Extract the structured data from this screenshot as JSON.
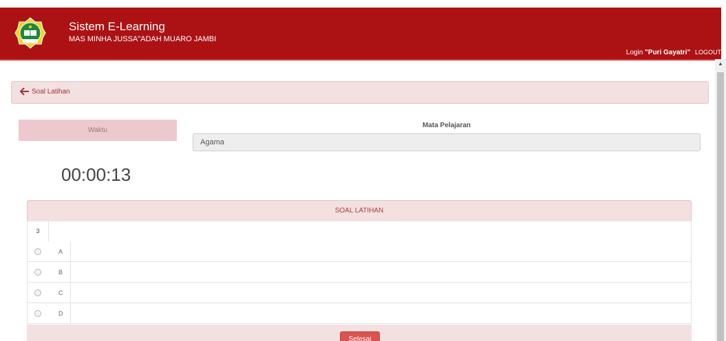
{
  "header": {
    "title": "Sistem E-Learning",
    "subtitle": "MAS MINHA JUSSA\"ADAH MUARO JAMBI",
    "login_prefix": "Login",
    "login_user": "\"Puri Gayatri\"",
    "logout_label": "LOGOUT"
  },
  "breadcrumb": {
    "label": "Soal Latihan"
  },
  "timer": {
    "label": "Waktu",
    "value": "00:00:13"
  },
  "mata_pelajaran": {
    "label": "Mata Pelajaran",
    "value": "Agama"
  },
  "quiz": {
    "header": "SOAL LATIHAN",
    "question_number": "3",
    "options": [
      {
        "label": "A"
      },
      {
        "label": "B"
      },
      {
        "label": "C"
      },
      {
        "label": "D"
      }
    ],
    "submit_label": "Selesai"
  },
  "colors": {
    "header_bg": "#ac1214",
    "panel_bg": "#f3e0e1",
    "button_bg": "#d9534f"
  }
}
